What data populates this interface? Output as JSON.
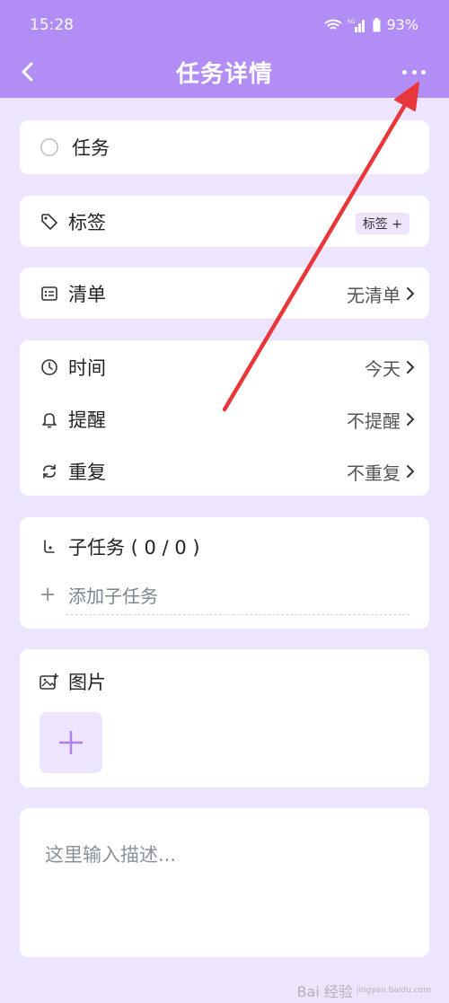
{
  "status_bar": {
    "time": "15:28",
    "battery": "93%"
  },
  "nav": {
    "title": "任务详情"
  },
  "task": {
    "name": "任务"
  },
  "tags": {
    "label": "标签",
    "button": "标签 +"
  },
  "list": {
    "label": "清单",
    "value": "无清单"
  },
  "schedule": {
    "time_label": "时间",
    "time_value": "今天",
    "reminder_label": "提醒",
    "reminder_value": "不提醒",
    "repeat_label": "重复",
    "repeat_value": "不重复"
  },
  "subtasks": {
    "title": "子任务 ( 0 / 0 )",
    "add_label": "添加子任务",
    "add_icon": "+"
  },
  "images": {
    "title": "图片"
  },
  "description": {
    "placeholder": "这里输入描述..."
  },
  "watermark": {
    "text": "Bai 经验",
    "url": "jingyan.baidu.com"
  },
  "colors": {
    "header": "#b28df5",
    "background": "#ede4fd",
    "card": "#ffffff",
    "arrow": "#e8363a",
    "accent_plus": "#b07fe8"
  }
}
